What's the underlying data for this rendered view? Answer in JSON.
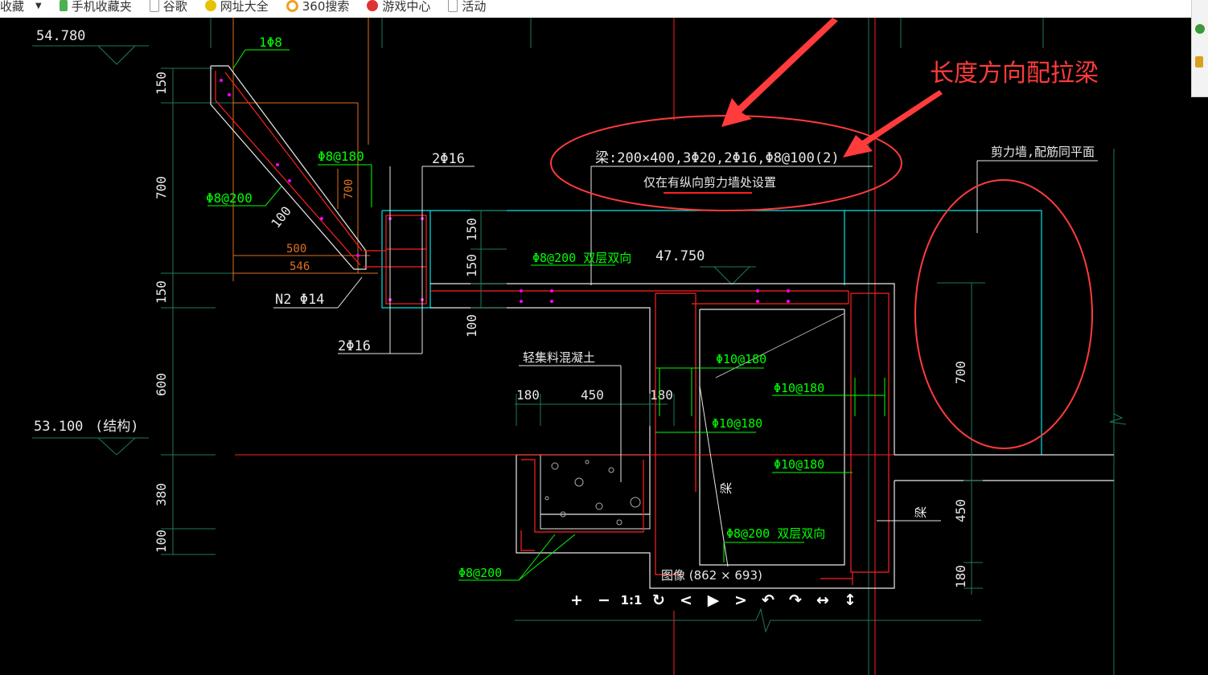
{
  "bookmarks_bar": {
    "items": [
      {
        "label": "收藏",
        "icon": "dropdown-icon"
      },
      {
        "label": "手机收藏夹",
        "icon": "phone-icon"
      },
      {
        "label": "谷歌",
        "icon": "page-icon"
      },
      {
        "label": "网址大全",
        "icon": "plus-circle-icon"
      },
      {
        "label": "360搜索",
        "icon": "search-360-icon"
      },
      {
        "label": "游戏中心",
        "icon": "game-icon"
      },
      {
        "label": "活动",
        "icon": "page-icon"
      }
    ]
  },
  "annotation": {
    "text": "长度方向配拉梁",
    "color": "#ff3b3b"
  },
  "viewer": {
    "info": "图像 (862 × 693)",
    "tools": [
      "+",
      "−",
      "1:1",
      "↻",
      "<",
      "▶",
      ">",
      "↶",
      "↷",
      "↔",
      "↕"
    ]
  },
  "drawing": {
    "elevations": [
      "54.780",
      "53.100",
      "47.750"
    ],
    "elevation_note": "(结构)",
    "beam_label": "梁:200×400,3Φ20,2Φ16,Φ8@100(2)",
    "beam_note": "仅在有纵向剪力墙处设置",
    "wall_label": "剪力墙,配筋同平面",
    "fill_label": "轻集料混凝土",
    "rebar": [
      "1Φ8",
      "Φ8@180",
      "Φ8@200",
      "2Φ16",
      "N2 Φ14",
      "2Φ16",
      "Φ8@200 双层双向",
      "Φ10@180",
      "Φ10@180",
      "Φ10@180",
      "Φ10@180",
      "Φ8@200 双层双向",
      "Φ8@200"
    ],
    "dims_left": [
      "150",
      "700",
      "150",
      "600",
      "380",
      "100"
    ],
    "dims_stair": [
      "100",
      "700",
      "500",
      "546"
    ],
    "dims_mid": [
      "150",
      "150",
      "100"
    ],
    "dims_bottom": [
      "180",
      "450",
      "180"
    ],
    "dims_right": [
      "700",
      "450",
      "180"
    ],
    "beam_tag": "梁",
    "colors": {
      "green": "#00ff00",
      "cyan": "#00e5e5",
      "red": "#ff2020",
      "white": "#e8e8e8",
      "orange": "#e07020",
      "magenta": "#ff00ff",
      "teal": "#1e7a5a"
    }
  }
}
